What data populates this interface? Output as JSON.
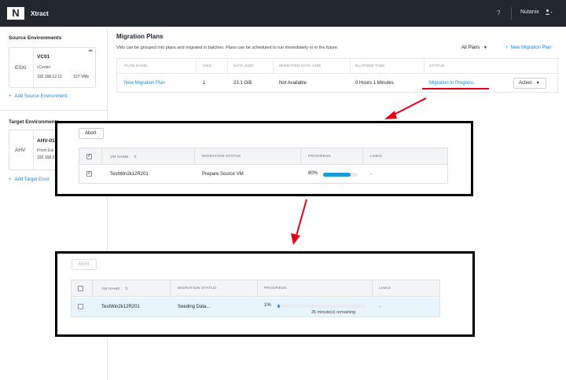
{
  "header": {
    "logo": "N",
    "app_title": "Xtract",
    "help": "?",
    "user": "Nutanix",
    "user_icon": "user-icon"
  },
  "sidebar": {
    "source_title": "Source Environments",
    "source_env": {
      "type": "ESXi",
      "name": "VC01",
      "sub": "vCenter",
      "ip": "192.168.12.11",
      "count": "127 VMs",
      "menu": "•••"
    },
    "add_source": "Add Source Environment",
    "target_title": "Target Environments",
    "target_env": {
      "type": "AHV",
      "name": "AHV-01",
      "sub": "Prism Ele",
      "ip": "192.168.2"
    },
    "add_target": "Add Target Envir"
  },
  "main": {
    "title": "Migration Plans",
    "description": "VMs can be grouped into plans and migrated in batches. Plans can be scheduled to run immediately or in the future.",
    "filter": "All Plans",
    "new_plan": "New Migration Plan",
    "plans_table": {
      "headers": [
        "PLAN NAME",
        "VMS",
        "DATA SIZE",
        "MIGRATED DATA SIZE",
        "ELAPSED TIME",
        "STATUS"
      ],
      "row": {
        "plan_name": "New Migration Plan",
        "vms": "1",
        "data_size": "23.1 GiB",
        "migrated": "Not Available",
        "elapsed": "0 Hours 1 Minutes",
        "status": "Migration In Progress",
        "action": "Action"
      }
    }
  },
  "popup1": {
    "abort": "Abort",
    "headers": [
      "VM NAME",
      "MIGRATION STATUS",
      "PROGRESS",
      "LINKS"
    ],
    "row": {
      "vm_name": "TestWin2k12R201",
      "status": "Prepare Source VM",
      "progress_label": "80%",
      "progress": 0.8,
      "links": "-"
    }
  },
  "popup2": {
    "abort": "Abort",
    "headers": [
      "VM NAME",
      "MIGRATION STATUS",
      "PROGRESS",
      "LINKS"
    ],
    "row": {
      "vm_name": "TestWin2k12R201",
      "status": "Seeding Data...",
      "progress_label": "1%",
      "progress": 0.01,
      "remaining": "35 minute(s) remaining",
      "links": "-"
    }
  },
  "colors": {
    "accent": "#1a8ad1",
    "highlight": "#e3001b",
    "progress": "#1b9bd7",
    "topbar": "#22272e"
  }
}
